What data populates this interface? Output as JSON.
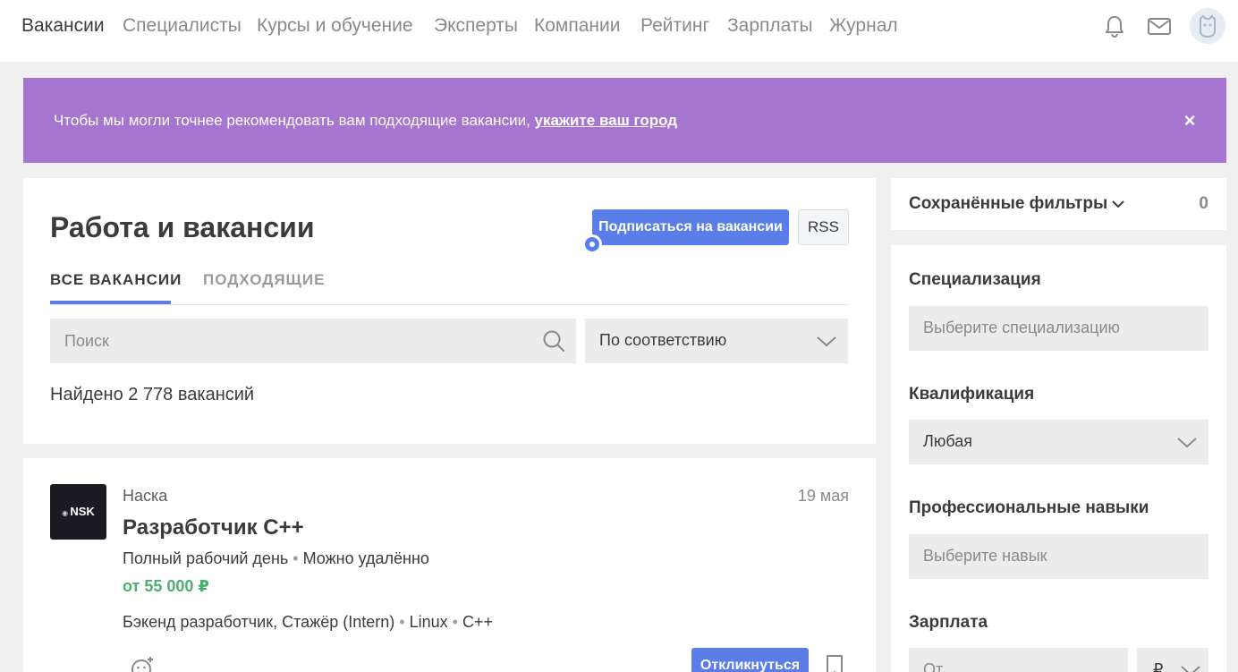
{
  "nav": {
    "items": [
      {
        "label": "Вакансии",
        "active": true
      },
      {
        "label": "Специалисты",
        "active": false
      },
      {
        "label": "Курсы и обучение",
        "active": false
      },
      {
        "label": "Эксперты",
        "active": false
      },
      {
        "label": "Компании",
        "active": false
      },
      {
        "label": "Рейтинг",
        "active": false
      },
      {
        "label": "Зарплаты",
        "active": false
      },
      {
        "label": "Журнал",
        "active": false
      }
    ],
    "icons": [
      "bell-icon",
      "mail-icon",
      "avatar"
    ]
  },
  "banner": {
    "text": "Чтобы мы могли точнее рекомендовать вам подходящие вакансии, ",
    "link": "укажите ваш город",
    "close": "×",
    "color": "#a675d0"
  },
  "main": {
    "title": "Работа и вакансии",
    "subscribe_label": "Подписаться на вакансии",
    "rss_label": "RSS",
    "tabs": [
      {
        "label": "ВСЕ ВАКАНСИИ",
        "active": true
      },
      {
        "label": "ПОДХОДЯЩИЕ",
        "active": false
      }
    ],
    "search": {
      "placeholder": "Поиск",
      "value": ""
    },
    "sort": {
      "selected": "По соответствию"
    },
    "found": "Найдено 2 778 вакансий"
  },
  "vacancy": {
    "logo_text": "NSK",
    "company": "Наска",
    "date": "19 мая",
    "title": "Разработчик C++",
    "conditions": [
      "Полный рабочий день",
      "Можно удалённо"
    ],
    "salary": "от 55 000 ₽",
    "skills": [
      "Бэкенд разработчик, Стажёр (Intern)",
      "Linux",
      "C++"
    ],
    "apply_label": "Откликнуться",
    "separator": "•"
  },
  "sidebar": {
    "saved_filters": {
      "label": "Сохранённые фильтры",
      "count": "0"
    },
    "filters": [
      {
        "label": "Специализация",
        "placeholder": "Выберите специализацию"
      },
      {
        "label": "Квалификация",
        "value": "Любая"
      },
      {
        "label": "Профессиональные навыки",
        "placeholder": "Выберите навык"
      },
      {
        "label": "Зарплата",
        "from_placeholder": "От",
        "currency": "₽"
      }
    ]
  },
  "colors": {
    "accent": "#5a7de8",
    "salary": "#4caf6e",
    "banner": "#a675d0"
  }
}
